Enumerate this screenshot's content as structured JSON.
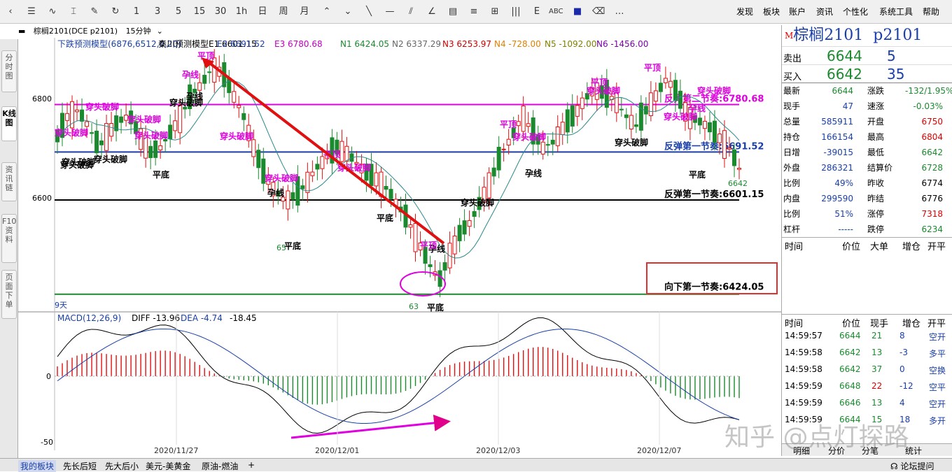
{
  "toolbar": {
    "digits": [
      "1",
      "3",
      "5",
      "15",
      "30"
    ],
    "periods": [
      "1h",
      "日",
      "周",
      "月"
    ],
    "abc": "ABC",
    "more": "…",
    "menus": [
      "发现",
      "板块",
      "账户",
      "资讯",
      "个性化",
      "系统工具",
      "帮助"
    ]
  },
  "subbar": {
    "symbol": "棕榈2101(DCE p2101)",
    "period": "15分钟"
  },
  "vtabs": [
    "分时图",
    "K线图",
    "资讯链",
    "F10资料",
    "页面下单"
  ],
  "indicator_line": {
    "name": "下跌预测模型(6876,6512,0,20)",
    "items": [
      {
        "label": "秦川预测模型E1 6601.15",
        "color": "#000000"
      },
      {
        "label": "E2 6691.52",
        "color": "#1a3fa8"
      },
      {
        "label": "E3 6780.68",
        "color": "#c000c0"
      },
      {
        "label": "N1 6424.05",
        "color": "#1b8a2e"
      },
      {
        "label": "N2 6337.29",
        "color": "#666666"
      },
      {
        "label": "N3 6253.97",
        "color": "#d00000"
      },
      {
        "label": "N4 -728.00",
        "color": "#e08000"
      },
      {
        "label": "N5 -1092.00",
        "color": "#808000"
      },
      {
        "label": "N6 -1456.00",
        "color": "#7a00aa"
      }
    ]
  },
  "macd_line": {
    "name": "MACD(12,26,9)",
    "items": [
      {
        "label": "DIFF -13.96",
        "color": "#000000"
      },
      {
        "label": "DEA -4.74",
        "color": "#1a3fa8"
      },
      {
        "label": "-18.45",
        "color": "#000000"
      }
    ]
  },
  "chart_data": {
    "type": "candlestick",
    "price_ticks": [
      "6800",
      "6600"
    ],
    "macd_ticks": [
      "0",
      "-50"
    ],
    "date_ticks": [
      "2020/11/27",
      "2020/12/01",
      "2020/12/03",
      "2020/12/07"
    ],
    "levels": [
      {
        "label": "反弹第二节奏:6780.68",
        "value": 6780.68,
        "color": "#e000e0"
      },
      {
        "label": "反弹第一节奏:6691.52",
        "value": 6691.52,
        "color": "#1a3fa8"
      },
      {
        "label": "反弹第一节奏:6601.15",
        "value": 6601.15,
        "color": "#000000"
      },
      {
        "label": "向下第一节奏:6424.05",
        "value": 6424.05,
        "color": "#1b8a2e"
      }
    ],
    "annotations_black": [
      "穿头破脚",
      "穿头破脚",
      "平底",
      "孕线",
      "穿头破脚",
      "穿头破脚",
      "孕线",
      "平底",
      "平底",
      "平底",
      "孕线",
      "穿头破脚",
      "孕线",
      "穿头破脚",
      "平底"
    ],
    "annotations_magenta": [
      "穿头破脚",
      "穿头破脚",
      "穿头破脚",
      "穿头破脚",
      "孕线",
      "穿头破脚",
      "平顶",
      "平顶",
      "穿头破脚",
      "穿头破脚",
      "平顶",
      "穿头破脚",
      "平顶",
      "穿头破脚",
      "平顶",
      "穿头破脚",
      "穿头破脚",
      "孕线",
      "平顶"
    ],
    "small_labels": [
      "9天",
      "6642",
      "65",
      "63"
    ],
    "price_range": [
      6400,
      6880
    ],
    "macd_range": [
      -50,
      40
    ]
  },
  "quote": {
    "title": "棕榈2101",
    "code": "p2101",
    "sell_label": "卖出",
    "sell_price": "6644",
    "sell_vol": "5",
    "buy_label": "买入",
    "buy_price": "6642",
    "buy_vol": "35",
    "stats": [
      [
        "最新",
        "6644",
        "涨跌",
        "-132/1.95%"
      ],
      [
        "现手",
        "47",
        "速涨",
        "-0.03%"
      ],
      [
        "总量",
        "585911",
        "开盘",
        "6750"
      ],
      [
        "持仓",
        "166154",
        "最高",
        "6804"
      ],
      [
        "日增",
        "-39015",
        "最低",
        "6642"
      ],
      [
        "外盘",
        "286321",
        "结算价",
        "6728"
      ],
      [
        "比例",
        "49%",
        "昨收",
        "6774"
      ],
      [
        "内盘",
        "299590",
        "昨结",
        "6776"
      ],
      [
        "比例",
        "51%",
        "涨停",
        "7318"
      ],
      [
        "杠杆",
        "-----",
        "跌停",
        "6234"
      ]
    ],
    "head1": [
      "时间",
      "价位",
      "大单",
      "增仓",
      "开平"
    ],
    "head2": [
      "时间",
      "价位",
      "现手",
      "增仓",
      "开平"
    ],
    "ticks": [
      [
        "14:59:57",
        "6644",
        "21",
        "8",
        "空开"
      ],
      [
        "14:59:58",
        "6642",
        "13",
        "-3",
        "多平"
      ],
      [
        "14:59:58",
        "6642",
        "37",
        "0",
        "空换"
      ],
      [
        "14:59:59",
        "6648",
        "22",
        "-12",
        "空平"
      ],
      [
        "14:59:59",
        "6646",
        "13",
        "4",
        "空开"
      ],
      [
        "14:59:59",
        "6644",
        "15",
        "18",
        "多开"
      ]
    ],
    "tabs": [
      "明细",
      "分价",
      "分笔",
      "统计"
    ]
  },
  "status": {
    "tabs": [
      "我的板块",
      "先长后短",
      "先大后小",
      "美元-美黄金",
      "原油-燃油",
      "+"
    ],
    "right": "论坛提问"
  },
  "watermark": "知乎 @点灯探路"
}
